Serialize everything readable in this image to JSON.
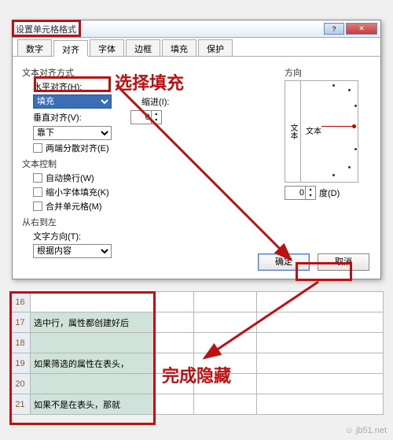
{
  "dialog": {
    "title": "设置单元格格式",
    "tabs": [
      "数字",
      "对齐",
      "字体",
      "边框",
      "填充",
      "保护"
    ],
    "active_tab": "对齐",
    "text_align_group": "文本对齐方式",
    "h_label": "水平对齐(H):",
    "h_value": "填充",
    "indent_label": "缩进(I):",
    "indent_value": "0",
    "v_label": "垂直对齐(V):",
    "v_value": "靠下",
    "justify_distrib": "两端分散对齐(E)",
    "text_control_group": "文本控制",
    "wrap": "自动换行(W)",
    "shrink": "缩小字体填充(K)",
    "merge": "合并单元格(M)",
    "rtl_group": "从右到左",
    "dir_label": "文字方向(T):",
    "dir_value": "根据内容",
    "orient_group": "方向",
    "orient_text_v": "文本",
    "orient_text": "文本",
    "deg_value": "0",
    "deg_label": "度(D)",
    "ok": "确定",
    "cancel": "取消"
  },
  "annot": {
    "a1": "选择填充",
    "a2": "完成隐藏"
  },
  "sheet": {
    "rows": [
      {
        "n": "16",
        "c1": "",
        "sel": false
      },
      {
        "n": "17",
        "c1": "选中行，属性都创建好后",
        "sel": true
      },
      {
        "n": "18",
        "c1": "",
        "sel": true
      },
      {
        "n": "19",
        "c1": "如果筛选的属性在表头，",
        "sel": true
      },
      {
        "n": "20",
        "c1": "",
        "sel": true
      },
      {
        "n": "21",
        "c1": "如果不是在表头，那就",
        "sel": true
      }
    ]
  },
  "watermark": "☺ jb51.net"
}
